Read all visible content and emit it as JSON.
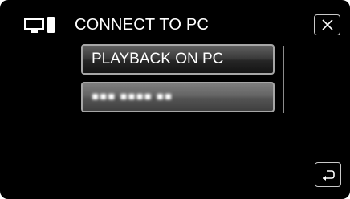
{
  "header": {
    "icon": "computer-connection-icon",
    "title": "CONNECT TO PC",
    "close_icon": "close-icon"
  },
  "menu": {
    "items": [
      {
        "label": "PLAYBACK ON PC",
        "state": "selected"
      },
      {
        "label": "...",
        "state": "unavailable"
      }
    ],
    "scrollbar_icon": "scrollbar"
  },
  "footer": {
    "back_icon": "return-icon"
  },
  "colors": {
    "background": "#000000",
    "text": "#ffffff",
    "border": "#a6a6a6"
  }
}
